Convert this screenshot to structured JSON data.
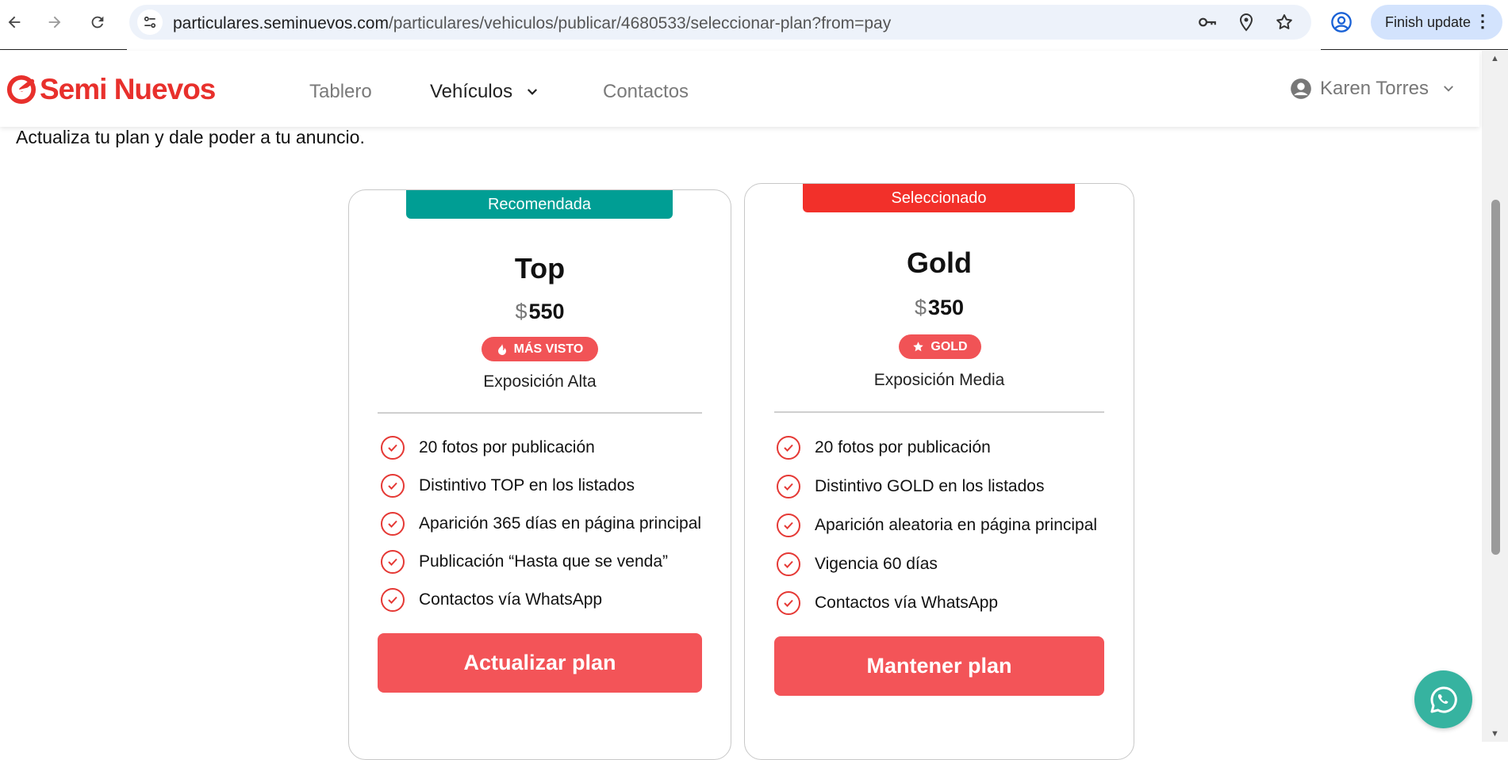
{
  "browser": {
    "url_host": "particulares.seminuevos.com",
    "url_path": "/particulares/vehiculos/publicar/4680533/seleccionar-plan?from=pay",
    "update_label": "Finish update"
  },
  "header": {
    "logo_text": "Semi Nuevos",
    "nav": [
      {
        "label": "Tablero"
      },
      {
        "label": "Vehículos"
      },
      {
        "label": "Contactos"
      }
    ],
    "user_name": "Karen Torres"
  },
  "page": {
    "subtitle": "Actualiza tu plan y dale poder a tu anuncio."
  },
  "plans": [
    {
      "ribbon": "Recomendada",
      "ribbon_color": "#009e94",
      "name": "Top",
      "currency": "$",
      "price": "550",
      "tag": "MÁS VISTO",
      "tag_icon": "fire-icon",
      "exposure": "Exposición Alta",
      "features": [
        "20 fotos por publicación",
        "Distintivo TOP en los listados",
        "Aparición 365 días en página principal",
        "Publicación “Hasta que se venda”",
        "Contactos vía WhatsApp"
      ],
      "cta": "Actualizar plan"
    },
    {
      "ribbon": "Seleccionado",
      "ribbon_color": "#f2302a",
      "name": "Gold",
      "currency": "$",
      "price": "350",
      "tag": "GOLD",
      "tag_icon": "star-icon",
      "exposure": "Exposición Media",
      "features": [
        "20 fotos por publicación",
        "Distintivo GOLD en los listados",
        "Aparición aleatoria en página principal",
        "Vigencia 60 días",
        "Contactos vía WhatsApp"
      ],
      "cta": "Mantener plan"
    }
  ],
  "colors": {
    "brand": "#e8302c",
    "cta": "#f35458",
    "whatsapp": "#36b3a0"
  }
}
